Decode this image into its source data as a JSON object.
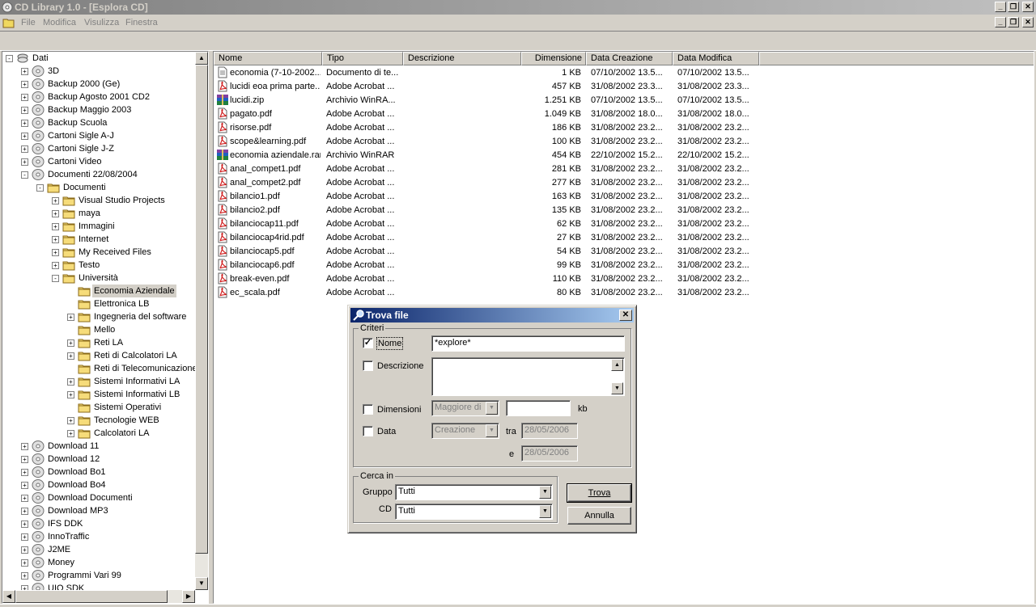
{
  "window": {
    "title": "CD Library 1.0 - [Esplora CD]",
    "controls": [
      "_",
      "❐",
      "✕"
    ]
  },
  "menu": [
    "File",
    "Modifica",
    "Visulizza",
    "Finestra"
  ],
  "tree": {
    "root": "Dati",
    "nodes": [
      {
        "label": "3D",
        "level": 1,
        "type": "cd",
        "exp": "+"
      },
      {
        "label": "Backup 2000 (Ge)",
        "level": 1,
        "type": "cd",
        "exp": "+"
      },
      {
        "label": "Backup Agosto 2001 CD2",
        "level": 1,
        "type": "cd",
        "exp": "+"
      },
      {
        "label": "Backup Maggio 2003",
        "level": 1,
        "type": "cd",
        "exp": "+"
      },
      {
        "label": "Backup Scuola",
        "level": 1,
        "type": "cd",
        "exp": "+"
      },
      {
        "label": "Cartoni Sigle A-J",
        "level": 1,
        "type": "cd",
        "exp": "+"
      },
      {
        "label": "Cartoni Sigle J-Z",
        "level": 1,
        "type": "cd",
        "exp": "+"
      },
      {
        "label": "Cartoni Video",
        "level": 1,
        "type": "cd",
        "exp": "+"
      },
      {
        "label": "Documenti 22/08/2004",
        "level": 1,
        "type": "cd",
        "exp": "-"
      },
      {
        "label": "Documenti",
        "level": 2,
        "type": "folder",
        "exp": "-"
      },
      {
        "label": "Visual Studio Projects",
        "level": 3,
        "type": "folder",
        "exp": "+"
      },
      {
        "label": "maya",
        "level": 3,
        "type": "folder",
        "exp": "+"
      },
      {
        "label": "Immagini",
        "level": 3,
        "type": "folder",
        "exp": "+"
      },
      {
        "label": "Internet",
        "level": 3,
        "type": "folder",
        "exp": "+"
      },
      {
        "label": "My Received Files",
        "level": 3,
        "type": "folder",
        "exp": "+"
      },
      {
        "label": "Testo",
        "level": 3,
        "type": "folder",
        "exp": "+"
      },
      {
        "label": "Università",
        "level": 3,
        "type": "folder",
        "exp": "-"
      },
      {
        "label": "Economia Aziendale",
        "level": 4,
        "type": "folder",
        "exp": "",
        "selected": true
      },
      {
        "label": "Elettronica LB",
        "level": 4,
        "type": "folder",
        "exp": ""
      },
      {
        "label": "Ingegneria del software",
        "level": 4,
        "type": "folder",
        "exp": "+"
      },
      {
        "label": "Mello",
        "level": 4,
        "type": "folder",
        "exp": ""
      },
      {
        "label": "Reti LA",
        "level": 4,
        "type": "folder",
        "exp": "+"
      },
      {
        "label": "Reti di Calcolatori LA",
        "level": 4,
        "type": "folder",
        "exp": "+"
      },
      {
        "label": "Reti di Telecomunicazione",
        "level": 4,
        "type": "folder",
        "exp": ""
      },
      {
        "label": "Sistemi Informativi LA",
        "level": 4,
        "type": "folder",
        "exp": "+"
      },
      {
        "label": "Sistemi Informativi LB",
        "level": 4,
        "type": "folder",
        "exp": "+"
      },
      {
        "label": "Sistemi Operativi",
        "level": 4,
        "type": "folder",
        "exp": ""
      },
      {
        "label": "Tecnologie WEB",
        "level": 4,
        "type": "folder",
        "exp": "+"
      },
      {
        "label": "Calcolatori LA",
        "level": 4,
        "type": "folder",
        "exp": "+"
      },
      {
        "label": "Download 11",
        "level": 1,
        "type": "cd",
        "exp": "+"
      },
      {
        "label": "Download 12",
        "level": 1,
        "type": "cd",
        "exp": "+"
      },
      {
        "label": "Download Bo1",
        "level": 1,
        "type": "cd",
        "exp": "+"
      },
      {
        "label": "Download Bo4",
        "level": 1,
        "type": "cd",
        "exp": "+"
      },
      {
        "label": "Download Documenti",
        "level": 1,
        "type": "cd",
        "exp": "+"
      },
      {
        "label": "Download MP3",
        "level": 1,
        "type": "cd",
        "exp": "+"
      },
      {
        "label": "IFS DDK",
        "level": 1,
        "type": "cd",
        "exp": "+"
      },
      {
        "label": "InnoTraffic",
        "level": 1,
        "type": "cd",
        "exp": "+"
      },
      {
        "label": "J2ME",
        "level": 1,
        "type": "cd",
        "exp": "+"
      },
      {
        "label": "Money",
        "level": 1,
        "type": "cd",
        "exp": "+"
      },
      {
        "label": "Programmi Vari 99",
        "level": 1,
        "type": "cd",
        "exp": "+"
      },
      {
        "label": "UIQ SDK",
        "level": 1,
        "type": "cd",
        "exp": "+"
      }
    ]
  },
  "list": {
    "columns": [
      "Nome",
      "Tipo",
      "Descrizione",
      "Dimensione",
      "Data Creazione",
      "Data Modifica"
    ],
    "rows": [
      {
        "icon": "txt",
        "name": "economia (7-10-2002...",
        "type": "Documento di te...",
        "size": "1 KB",
        "created": "07/10/2002 13.5...",
        "modified": "07/10/2002 13.5..."
      },
      {
        "icon": "pdf",
        "name": "lucidi eoa prima parte...",
        "type": "Adobe Acrobat ...",
        "size": "457 KB",
        "created": "31/08/2002 23.3...",
        "modified": "31/08/2002 23.3..."
      },
      {
        "icon": "rar",
        "name": "lucidi.zip",
        "type": "Archivio WinRA...",
        "size": "1.251 KB",
        "created": "07/10/2002 13.5...",
        "modified": "07/10/2002 13.5..."
      },
      {
        "icon": "pdf",
        "name": "pagato.pdf",
        "type": "Adobe Acrobat ...",
        "size": "1.049 KB",
        "created": "31/08/2002 18.0...",
        "modified": "31/08/2002 18.0..."
      },
      {
        "icon": "pdf",
        "name": "risorse.pdf",
        "type": "Adobe Acrobat ...",
        "size": "186 KB",
        "created": "31/08/2002 23.2...",
        "modified": "31/08/2002 23.2..."
      },
      {
        "icon": "pdf",
        "name": "scope&learning.pdf",
        "type": "Adobe Acrobat ...",
        "size": "100 KB",
        "created": "31/08/2002 23.2...",
        "modified": "31/08/2002 23.2..."
      },
      {
        "icon": "rar",
        "name": "economia aziendale.rar",
        "type": "Archivio WinRAR",
        "size": "454 KB",
        "created": "22/10/2002 15.2...",
        "modified": "22/10/2002 15.2..."
      },
      {
        "icon": "pdf",
        "name": "anal_compet1.pdf",
        "type": "Adobe Acrobat ...",
        "size": "281 KB",
        "created": "31/08/2002 23.2...",
        "modified": "31/08/2002 23.2..."
      },
      {
        "icon": "pdf",
        "name": "anal_compet2.pdf",
        "type": "Adobe Acrobat ...",
        "size": "277 KB",
        "created": "31/08/2002 23.2...",
        "modified": "31/08/2002 23.2..."
      },
      {
        "icon": "pdf",
        "name": "bilancio1.pdf",
        "type": "Adobe Acrobat ...",
        "size": "163 KB",
        "created": "31/08/2002 23.2...",
        "modified": "31/08/2002 23.2..."
      },
      {
        "icon": "pdf",
        "name": "bilancio2.pdf",
        "type": "Adobe Acrobat ...",
        "size": "135 KB",
        "created": "31/08/2002 23.2...",
        "modified": "31/08/2002 23.2..."
      },
      {
        "icon": "pdf",
        "name": "bilanciocap11.pdf",
        "type": "Adobe Acrobat ...",
        "size": "62 KB",
        "created": "31/08/2002 23.2...",
        "modified": "31/08/2002 23.2..."
      },
      {
        "icon": "pdf",
        "name": "bilanciocap4rid.pdf",
        "type": "Adobe Acrobat ...",
        "size": "27 KB",
        "created": "31/08/2002 23.2...",
        "modified": "31/08/2002 23.2..."
      },
      {
        "icon": "pdf",
        "name": "bilanciocap5.pdf",
        "type": "Adobe Acrobat ...",
        "size": "54 KB",
        "created": "31/08/2002 23.2...",
        "modified": "31/08/2002 23.2..."
      },
      {
        "icon": "pdf",
        "name": "bilanciocap6.pdf",
        "type": "Adobe Acrobat ...",
        "size": "99 KB",
        "created": "31/08/2002 23.2...",
        "modified": "31/08/2002 23.2..."
      },
      {
        "icon": "pdf",
        "name": "break-even.pdf",
        "type": "Adobe Acrobat ...",
        "size": "110 KB",
        "created": "31/08/2002 23.2...",
        "modified": "31/08/2002 23.2..."
      },
      {
        "icon": "pdf",
        "name": "ec_scala.pdf",
        "type": "Adobe Acrobat ...",
        "size": "80 KB",
        "created": "31/08/2002 23.2...",
        "modified": "31/08/2002 23.2..."
      }
    ]
  },
  "dialog": {
    "title": "Trova file",
    "criteria_label": "Criteri",
    "nome_label": "Nome",
    "nome_checked": true,
    "nome_value": "*explore*",
    "descrizione_label": "Descrizione",
    "descrizione_value": "",
    "dimensioni_label": "Dimensioni",
    "dimensioni_op": "Maggiore di",
    "dimensioni_value": "",
    "kb_label": "kb",
    "data_label": "Data",
    "data_type": "Creazione",
    "tra_label": "tra",
    "date_from": "28/05/2006",
    "e_label": "e",
    "date_to": "28/05/2006",
    "cerca_label": "Cerca in",
    "gruppo_label": "Gruppo",
    "gruppo_value": "Tutti",
    "cd_label": "CD",
    "cd_value": "Tutti",
    "trova_button": "Trova",
    "annulla_button": "Annulla"
  },
  "colors": {
    "title_inactive": "#808080",
    "dialog_title": "#0a246a",
    "face": "#d4d0c8"
  }
}
